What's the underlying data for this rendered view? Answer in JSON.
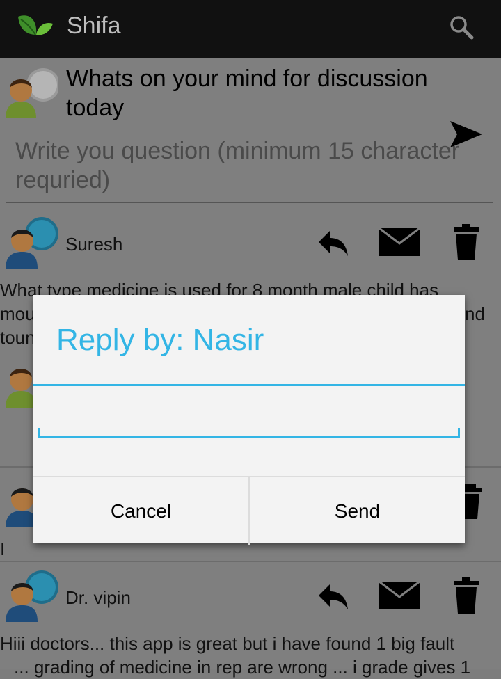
{
  "app": {
    "title": "Shifa"
  },
  "compose": {
    "title": "Whats on your mind for discussion today",
    "placeholder": "Write you question (minimum 15 character requried)"
  },
  "posts": [
    {
      "author": "Suresh",
      "body_line1": "What type medicine is used for 8 month male child has",
      "body_line2": "mou",
      "body_line2_right": "nd",
      "body_line3": "toun"
    },
    {
      "author": "",
      "body_line1": "I"
    },
    {
      "author": "Dr. vipin",
      "body_line1": "Hiii doctors... this app is great but i have found 1 big fault",
      "body_line2": "... grading of medicine in rep are wrong ... i grade gives 1"
    }
  ],
  "dialog": {
    "title": "Reply by: Nasir",
    "input_value": "",
    "cancel_label": "Cancel",
    "send_label": "Send"
  },
  "colors": {
    "accent": "#33b5e5",
    "actionbar": "#111111"
  }
}
